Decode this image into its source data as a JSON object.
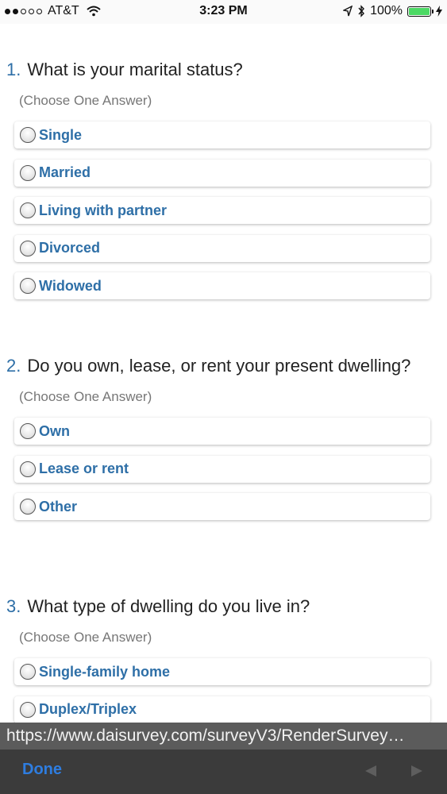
{
  "status_bar": {
    "carrier": "AT&T",
    "time": "3:23 PM",
    "battery": "100%"
  },
  "questions": [
    {
      "number": "1.",
      "text": "What is your marital status?",
      "instruction": "(Choose One Answer)",
      "options": [
        "Single",
        "Married",
        "Living with partner",
        "Divorced",
        "Widowed"
      ]
    },
    {
      "number": "2.",
      "text": "Do you own, lease, or rent your present dwelling?",
      "instruction": "(Choose One Answer)",
      "options": [
        "Own",
        "Lease or rent",
        "Other"
      ]
    },
    {
      "number": "3.",
      "text": "What type of dwelling do you live in?",
      "instruction": "(Choose One Answer)",
      "options": [
        "Single-family home",
        "Duplex/Triplex"
      ]
    }
  ],
  "browser": {
    "url": "https://www.daisurvey.com/surveyV3/RenderSurvey…",
    "done_label": "Done"
  },
  "colors": {
    "accent": "#2e6fa7",
    "done": "#2e7de0",
    "battery": "#4cd964"
  }
}
